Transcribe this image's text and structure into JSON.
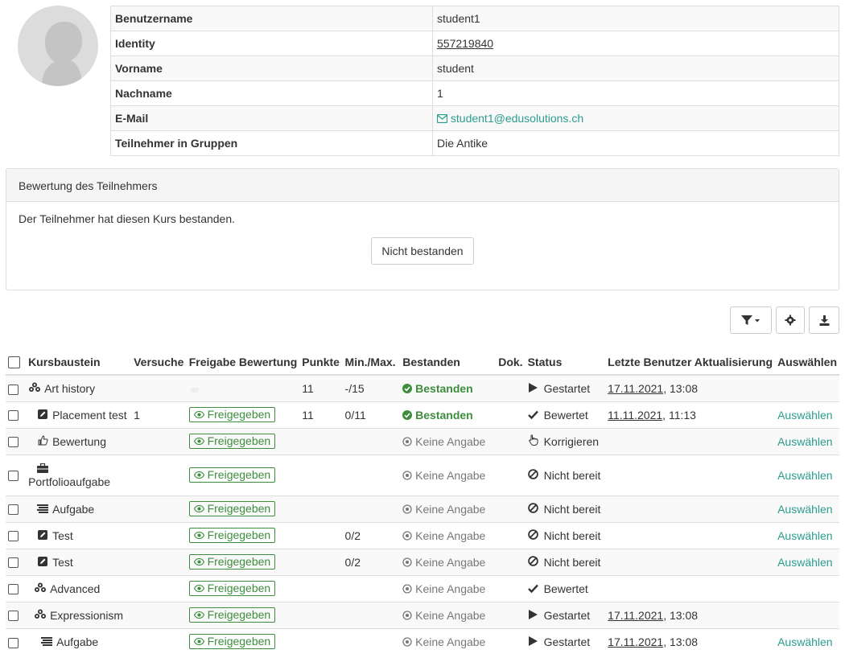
{
  "profile": {
    "fields": [
      {
        "key": "Benutzername",
        "value": "student1"
      },
      {
        "key": "Identity",
        "value": "557219840"
      },
      {
        "key": "Vorname",
        "value": "student"
      },
      {
        "key": "Nachname",
        "value": "1"
      },
      {
        "key": "E-Mail",
        "value": "student1@edusolutions.ch"
      },
      {
        "key": "Teilnehmer in Gruppen",
        "value": "Die Antike"
      }
    ]
  },
  "assessment": {
    "title": "Bewertung des Teilnehmers",
    "message": "Der Teilnehmer hat diesen Kurs bestanden.",
    "button": "Nicht bestanden"
  },
  "table": {
    "headers": [
      "Kursbaustein",
      "Versuche",
      "Freigabe Bewertung",
      "Punkte",
      "Min./Max.",
      "Bestanden",
      "Dok.",
      "Status",
      "Letzte Benutzer Aktualisierung",
      "Auswählen"
    ],
    "rows": [
      {
        "icon": "course-structure-icon",
        "name": "Art history",
        "attempts": "",
        "release": "",
        "points": "11",
        "minmax": "-/15",
        "passed": "Bestanden",
        "passed_type": "pass",
        "status_icon": "play-icon",
        "status": "Gestartet",
        "date": "17.11.2021",
        "time": ", 13:08",
        "select": ""
      },
      {
        "icon": "test-icon",
        "name": "Placement test",
        "attempts": "1",
        "release": "Freigegeben",
        "points": "11",
        "minmax": "0/11",
        "passed": "Bestanden",
        "passed_type": "pass",
        "status_icon": "check-icon",
        "status": "Bewertet",
        "date": "11.11.2021",
        "time": ", 11:13",
        "select": "Auswählen"
      },
      {
        "icon": "thumbs-up-icon",
        "name": "Bewertung",
        "attempts": "",
        "release": "Freigegeben",
        "points": "",
        "minmax": "",
        "passed": "Keine Angabe",
        "passed_type": "none",
        "status_icon": "pointer-icon",
        "status": "Korrigieren",
        "date": "",
        "time": "",
        "select": "Auswählen"
      },
      {
        "icon": "briefcase-icon",
        "name": "Portfolioaufgabe",
        "attempts": "",
        "release": "Freigegeben",
        "points": "",
        "minmax": "",
        "passed": "Keine Angabe",
        "passed_type": "none",
        "status_icon": "ban-icon",
        "status": "Nicht bereit",
        "date": "",
        "time": "",
        "select": "Auswählen"
      },
      {
        "icon": "task-icon",
        "name": "Aufgabe",
        "attempts": "",
        "release": "Freigegeben",
        "points": "",
        "minmax": "",
        "passed": "Keine Angabe",
        "passed_type": "none",
        "status_icon": "ban-icon",
        "status": "Nicht bereit",
        "date": "",
        "time": "",
        "select": "Auswählen"
      },
      {
        "icon": "test-icon",
        "name": "Test",
        "attempts": "",
        "release": "Freigegeben",
        "points": "",
        "minmax": "0/2",
        "passed": "Keine Angabe",
        "passed_type": "none",
        "status_icon": "ban-icon",
        "status": "Nicht bereit",
        "date": "",
        "time": "",
        "select": "Auswählen"
      },
      {
        "icon": "test-icon",
        "name": "Test",
        "attempts": "",
        "release": "Freigegeben",
        "points": "",
        "minmax": "0/2",
        "passed": "Keine Angabe",
        "passed_type": "none",
        "status_icon": "ban-icon",
        "status": "Nicht bereit",
        "date": "",
        "time": "",
        "select": "Auswählen"
      },
      {
        "icon": "course-structure-icon",
        "name": "Advanced",
        "attempts": "",
        "release": "Freigegeben",
        "points": "",
        "minmax": "",
        "passed": "Keine Angabe",
        "passed_type": "none",
        "status_icon": "check-icon",
        "status": "Bewertet",
        "date": "",
        "time": "",
        "select": ""
      },
      {
        "icon": "course-structure-icon",
        "name": "Expressionism",
        "attempts": "",
        "release": "Freigegeben",
        "points": "",
        "minmax": "",
        "passed": "Keine Angabe",
        "passed_type": "none",
        "status_icon": "play-icon",
        "status": "Gestartet",
        "date": "17.11.2021",
        "time": ", 13:08",
        "select": ""
      },
      {
        "icon": "task-icon",
        "name": "Aufgabe",
        "attempts": "",
        "release": "Freigegeben",
        "points": "",
        "minmax": "",
        "passed": "Keine Angabe",
        "passed_type": "none",
        "status_icon": "play-icon",
        "status": "Gestartet",
        "date": "17.11.2021",
        "time": ", 13:08",
        "select": "Auswählen"
      }
    ]
  },
  "colors": {
    "accent": "#2a9d8f",
    "success": "#3c8d3c",
    "muted": "#777777"
  }
}
